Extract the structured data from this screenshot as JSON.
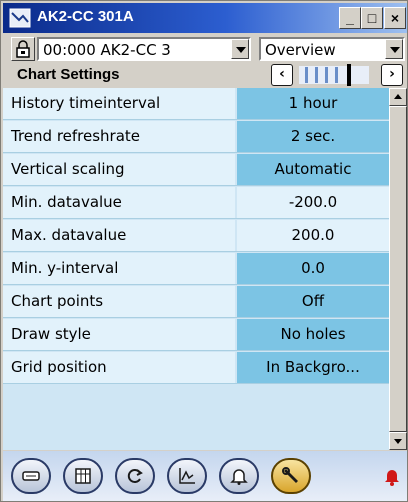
{
  "window": {
    "title": "AK2-CC 301A",
    "min_glyph": "_",
    "max_glyph": "□",
    "close_glyph": "×"
  },
  "toolbar": {
    "device_select": "00:000 AK2-CC 3",
    "view_select": "Overview",
    "section_title": "Chart Settings",
    "stepper_left_glyph": "‹",
    "stepper_right_glyph": "›"
  },
  "settings": [
    {
      "label": "History timeinterval",
      "value": "1 hour",
      "style": "dark"
    },
    {
      "label": "Trend refreshrate",
      "value": "2 sec.",
      "style": "dark"
    },
    {
      "label": "Vertical scaling",
      "value": "Automatic",
      "style": "dark"
    },
    {
      "label": "Min. datavalue",
      "value": "-200.0",
      "style": "light"
    },
    {
      "label": "Max. datavalue",
      "value": "200.0",
      "style": "light"
    },
    {
      "label": "Min. y-interval",
      "value": "0.0",
      "style": "dark"
    },
    {
      "label": "Chart points",
      "value": "Off",
      "style": "dark"
    },
    {
      "label": "Draw style",
      "value": "No holes",
      "style": "dark"
    },
    {
      "label": "Grid position",
      "value": "In Backgro...",
      "style": "dark"
    }
  ],
  "bottom_nav": [
    {
      "icon": "device-icon",
      "active": false
    },
    {
      "icon": "table-icon",
      "active": false
    },
    {
      "icon": "refresh-icon",
      "active": false
    },
    {
      "icon": "chart-icon",
      "active": false
    },
    {
      "icon": "bell-icon",
      "active": false
    },
    {
      "icon": "wrench-icon",
      "active": true
    }
  ],
  "colors": {
    "value_dark": "#7cc4e4",
    "value_light": "#e2f2fb",
    "alarm": "#d01818"
  }
}
